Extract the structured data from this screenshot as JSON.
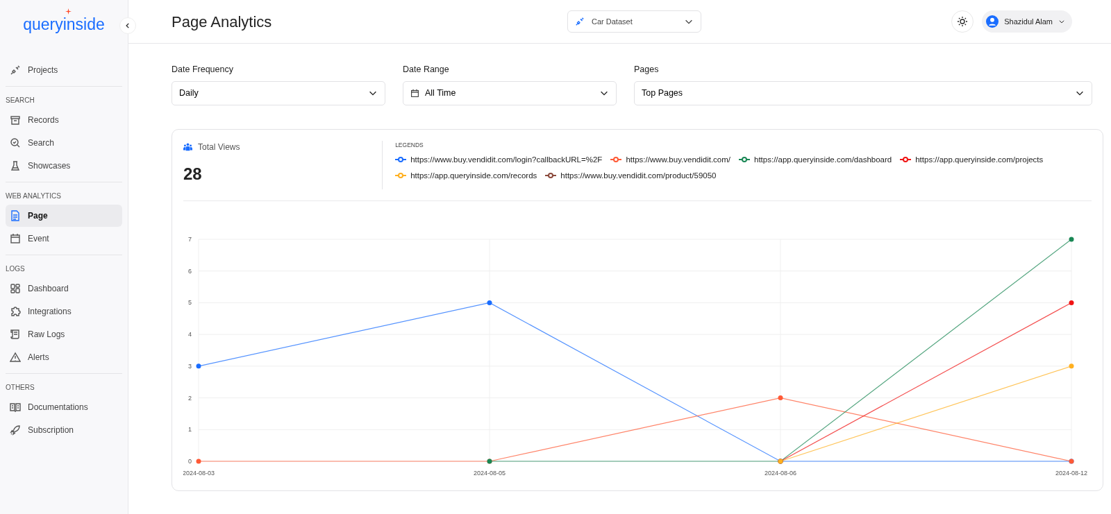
{
  "sidebar": {
    "logo": "queryinside",
    "sections": [
      {
        "items": [
          {
            "label": "Projects",
            "selected": false
          }
        ]
      },
      {
        "heading": "SEARCH",
        "items": [
          {
            "label": "Records",
            "selected": false
          },
          {
            "label": "Search",
            "selected": false
          },
          {
            "label": "Showcases",
            "selected": false
          }
        ]
      },
      {
        "heading": "WEB ANALYTICS",
        "items": [
          {
            "label": "Page",
            "selected": true
          },
          {
            "label": "Event",
            "selected": false
          }
        ]
      },
      {
        "heading": "LOGS",
        "items": [
          {
            "label": "Dashboard",
            "selected": false
          },
          {
            "label": "Integrations",
            "selected": false
          },
          {
            "label": "Raw Logs",
            "selected": false
          },
          {
            "label": "Alerts",
            "selected": false
          }
        ]
      },
      {
        "heading": "OTHERS",
        "items": [
          {
            "label": "Documentations",
            "selected": false
          },
          {
            "label": "Subscription",
            "selected": false
          }
        ]
      }
    ]
  },
  "header": {
    "title": "Page Analytics",
    "dataset": "Car Dataset",
    "user": "Shazidul Alam"
  },
  "filters": [
    {
      "label": "Date Frequency",
      "value": "Daily",
      "kind": "select"
    },
    {
      "label": "Date Range",
      "value": "All Time",
      "kind": "date"
    },
    {
      "label": "Pages",
      "value": "Top Pages",
      "kind": "select"
    }
  ],
  "stats": {
    "label": "Total Views",
    "value": "28"
  },
  "legend": {
    "heading": "LEGENDS"
  },
  "chart_data": {
    "type": "line",
    "grid": true,
    "categories": [
      "2024-08-03",
      "2024-08-05",
      "2024-08-06",
      "2024-08-12"
    ],
    "ylim": [
      0,
      7
    ],
    "yticks": [
      0,
      1,
      2,
      3,
      4,
      5,
      6,
      7
    ],
    "series": [
      {
        "name": "https://www.buy.vendidit.com/login?callbackURL=%2F",
        "color": "#1a6dff",
        "marker": "circle",
        "values": [
          3,
          5,
          0,
          0
        ]
      },
      {
        "name": "https://www.buy.vendidit.com/",
        "color": "#ff5a36",
        "marker": "circle",
        "values": [
          0,
          0,
          2,
          0
        ]
      },
      {
        "name": "https://app.queryinside.com/dashboard",
        "color": "#198754",
        "marker": "circle",
        "values": [
          null,
          0,
          0,
          7
        ]
      },
      {
        "name": "https://app.queryinside.com/projects",
        "color": "#f01414",
        "marker": "circle",
        "values": [
          null,
          null,
          0,
          5
        ]
      },
      {
        "name": "https://app.queryinside.com/records",
        "color": "#ffb020",
        "marker": "circle",
        "values": [
          null,
          null,
          0,
          3
        ]
      },
      {
        "name": "https://www.buy.vendidit.com/product/59050",
        "color": "#8b4a3c",
        "marker": "circle",
        "values": [
          null,
          null,
          null,
          null
        ]
      }
    ]
  }
}
